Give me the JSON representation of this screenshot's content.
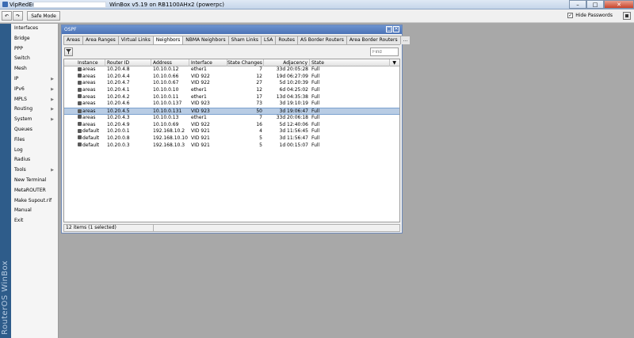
{
  "window": {
    "title_left": "VipRedE@",
    "title_right": "WinBox v5.19 on RB1100AHx2 (powerpc)",
    "min_label": "–",
    "max_label": "□",
    "close_label": "✕"
  },
  "toolbar": {
    "undo_glyph": "↶",
    "redo_glyph": "↷",
    "safe_mode_label": "Safe Mode",
    "hide_passwords_label": "Hide Passwords",
    "hide_passwords_checked": true,
    "check_glyph": "✓"
  },
  "brand": "RouterOS WinBox",
  "sidebar": {
    "items": [
      {
        "label": "Interfaces",
        "arrow": ""
      },
      {
        "label": "Bridge",
        "arrow": ""
      },
      {
        "label": "PPP",
        "arrow": ""
      },
      {
        "label": "Switch",
        "arrow": ""
      },
      {
        "label": "Mesh",
        "arrow": ""
      },
      {
        "label": "IP",
        "arrow": "▶"
      },
      {
        "label": "IPv6",
        "arrow": "▶"
      },
      {
        "label": "MPLS",
        "arrow": "▶"
      },
      {
        "label": "Routing",
        "arrow": "▶"
      },
      {
        "label": "System",
        "arrow": "▶"
      },
      {
        "label": "Queues",
        "arrow": ""
      },
      {
        "label": "Files",
        "arrow": ""
      },
      {
        "label": "Log",
        "arrow": ""
      },
      {
        "label": "Radius",
        "arrow": ""
      },
      {
        "label": "Tools",
        "arrow": "▶"
      },
      {
        "label": "New Terminal",
        "arrow": ""
      },
      {
        "label": "MetaROUTER",
        "arrow": ""
      },
      {
        "label": "Make Supout.rif",
        "arrow": ""
      },
      {
        "label": "Manual",
        "arrow": ""
      },
      {
        "label": "Exit",
        "arrow": ""
      }
    ]
  },
  "ospf": {
    "title": "OSPF",
    "max_glyph": "□",
    "close_glyph": "✕",
    "tabs": [
      "Areas",
      "Area Ranges",
      "Virtual Links",
      "Neighbors",
      "NBMA Neighbors",
      "Sham Links",
      "LSA",
      "Routes",
      "AS Border Routers",
      "Area Border Routers",
      "..."
    ],
    "active_tab": "Neighbors",
    "filter_glyph": "▼",
    "find_placeholder": "Find",
    "columns": [
      "Instance",
      "Router ID",
      "Address",
      "Interface",
      "State Changes",
      "Adjacency",
      "State"
    ],
    "column_menu_glyph": "▼",
    "rows": [
      {
        "instance": "areas",
        "router_id": "10.20.4.8",
        "address": "10.10.0.12",
        "interface": "ether1",
        "state_changes": "7",
        "adjacency": "33d 20:05:28",
        "state": "Full",
        "selected": false
      },
      {
        "instance": "areas",
        "router_id": "10.20.4.4",
        "address": "10.10.0.66",
        "interface": "VID 922",
        "state_changes": "12",
        "adjacency": "19d 06:27:09",
        "state": "Full",
        "selected": false
      },
      {
        "instance": "areas",
        "router_id": "10.20.4.7",
        "address": "10.10.0.67",
        "interface": "VID 922",
        "state_changes": "27",
        "adjacency": "5d 10:20:39",
        "state": "Full",
        "selected": false
      },
      {
        "instance": "areas",
        "router_id": "10.20.4.1",
        "address": "10.10.0.10",
        "interface": "ether1",
        "state_changes": "12",
        "adjacency": "6d 04:25:02",
        "state": "Full",
        "selected": false
      },
      {
        "instance": "areas",
        "router_id": "10.20.4.2",
        "address": "10.10.0.11",
        "interface": "ether1",
        "state_changes": "17",
        "adjacency": "13d 04:35:38",
        "state": "Full",
        "selected": false
      },
      {
        "instance": "areas",
        "router_id": "10.20.4.6",
        "address": "10.10.0.137",
        "interface": "VID 923",
        "state_changes": "73",
        "adjacency": "3d 19:10:19",
        "state": "Full",
        "selected": false
      },
      {
        "instance": "areas",
        "router_id": "10.20.4.5",
        "address": "10.10.0.131",
        "interface": "VID 923",
        "state_changes": "50",
        "adjacency": "3d 19:06:47",
        "state": "Full",
        "selected": true
      },
      {
        "instance": "areas",
        "router_id": "10.20.4.3",
        "address": "10.10.0.13",
        "interface": "ether1",
        "state_changes": "7",
        "adjacency": "33d 20:06:18",
        "state": "Full",
        "selected": false
      },
      {
        "instance": "areas",
        "router_id": "10.20.4.9",
        "address": "10.10.0.69",
        "interface": "VID 922",
        "state_changes": "16",
        "adjacency": "5d 12:40:06",
        "state": "Full",
        "selected": false
      },
      {
        "instance": "default",
        "router_id": "10.20.0.1",
        "address": "192.168.10.2",
        "interface": "VID 921",
        "state_changes": "4",
        "adjacency": "3d 11:56:45",
        "state": "Full",
        "selected": false
      },
      {
        "instance": "default",
        "router_id": "10.20.0.8",
        "address": "192.168.10.10",
        "interface": "VID 921",
        "state_changes": "5",
        "adjacency": "3d 11:56:47",
        "state": "Full",
        "selected": false
      },
      {
        "instance": "default",
        "router_id": "10.20.0.3",
        "address": "192.168.10.3",
        "interface": "VID 921",
        "state_changes": "5",
        "adjacency": "1d 00:15:07",
        "state": "Full",
        "selected": false
      }
    ],
    "status_text": "12 items (1 selected)"
  },
  "colors": {
    "brand_strip": "#2e5c8a",
    "title_bar_active": "#4b72b7",
    "selected_row": "#b8cce4"
  }
}
